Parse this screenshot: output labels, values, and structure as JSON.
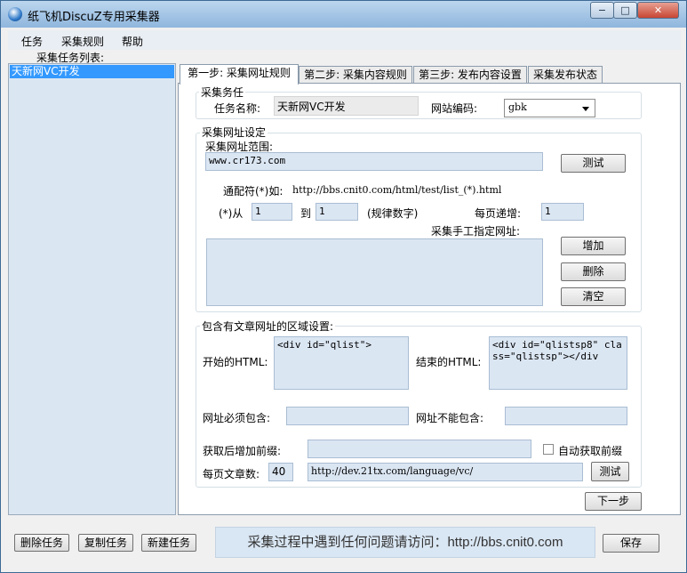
{
  "app": {
    "title": "纸飞机DiscuZ专用采集器",
    "window_controls": {
      "minimize": "−",
      "maximize": "□",
      "close": "✕"
    }
  },
  "menu": [
    "任务",
    "采集规则",
    "帮助"
  ],
  "task_list": {
    "label": "采集任务列表:",
    "items": [
      "天新网VC开发"
    ]
  },
  "tabs": [
    "第一步: 采集网址规则",
    "第二步: 采集内容规则",
    "第三步: 发布内容设置",
    "采集发布状态"
  ],
  "task_group": {
    "title": "采集务任",
    "name_label": "任务名称:",
    "name_value": "天新网VC开发",
    "encoding_label": "网站编码:",
    "encoding_value": "gbk"
  },
  "url_group": {
    "title": "采集网址设定",
    "range_label": "采集网址范围:",
    "range_value": "www.cr173.com",
    "test_button": "测试",
    "wildcard_label": "通配符(*)如:",
    "wildcard_example": "http://bbs.cnit0.com/html/test/list_(*).html",
    "from_label": "(*)从",
    "from_value": "1",
    "to_label": "到",
    "to_value": "1",
    "rule_hint": "(规律数字)",
    "increment_label": "每页递增:",
    "increment_value": "1",
    "manual_label": "采集手工指定网址:",
    "manual_value": "",
    "add_button": "增加",
    "delete_button": "删除",
    "clear_button": "清空"
  },
  "region_group": {
    "title": "包含有文章网址的区域设置:",
    "start_label": "开始的HTML:",
    "start_value": "<div id=\"qlist\">",
    "end_label": "结束的HTML:",
    "end_value": "<div id=\"qlistsp8\" class=\"qlistsp\"></div",
    "must_contain_label": "网址必须包含:",
    "must_contain_value": "",
    "not_contain_label": "网址不能包含:",
    "not_contain_value": "",
    "prefix_label": "获取后增加前缀:",
    "prefix_value": "",
    "auto_prefix_label": "自动获取前缀",
    "auto_prefix_checked": false,
    "per_page_label": "每页文章数:",
    "per_page_value": "40",
    "test_url_value": "http://dev.21tx.com/language/vc/",
    "test_button": "测试"
  },
  "next_button": "下一步",
  "footer": {
    "delete_task": "删除任务",
    "copy_task": "复制任务",
    "new_task": "新建任务",
    "status_text": "采集过程中遇到任何问题请访问：http://bbs.cnit0.com",
    "save": "保存"
  }
}
